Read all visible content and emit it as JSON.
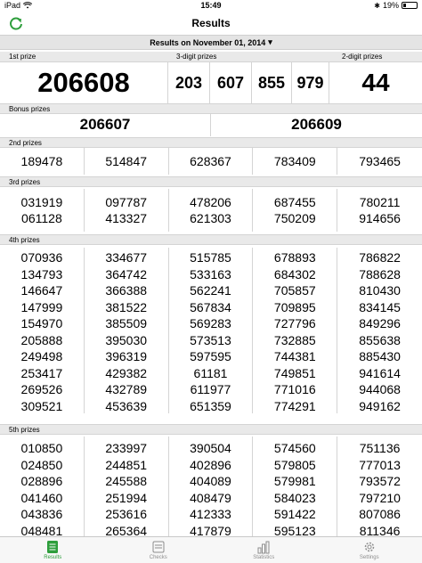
{
  "status": {
    "device": "iPad",
    "time": "15:49",
    "battery": "19%",
    "battery_level": 0.19
  },
  "nav": {
    "title": "Results"
  },
  "date_selector": {
    "label": "Results on November 01, 2014",
    "arrow": "▾"
  },
  "headers": {
    "first": "1st prize",
    "three_digit": "3-digit prizes",
    "two_digit": "2-digit prizes",
    "bonus": "Bonus prizes",
    "second": "2nd prizes",
    "third": "3rd prizes",
    "fourth": "4th prizes",
    "fifth": "5th prizes"
  },
  "first_prize": "206608",
  "three_digit": [
    "203",
    "607",
    "855",
    "979"
  ],
  "two_digit": "44",
  "bonus": [
    "206607",
    "206609"
  ],
  "second": [
    [
      "189478"
    ],
    [
      "514847"
    ],
    [
      "628367"
    ],
    [
      "783409"
    ],
    [
      "793465"
    ]
  ],
  "third": [
    [
      "031919",
      "061128"
    ],
    [
      "097787",
      "413327"
    ],
    [
      "478206",
      "621303"
    ],
    [
      "687455",
      "750209"
    ],
    [
      "780211",
      "914656"
    ]
  ],
  "fourth": [
    [
      "070936",
      "134793",
      "146647",
      "147999",
      "154970",
      "205888",
      "249498",
      "253417",
      "269526",
      "309521"
    ],
    [
      "334677",
      "364742",
      "366388",
      "381522",
      "385509",
      "395030",
      "396319",
      "429382",
      "432789",
      "453639"
    ],
    [
      "515785",
      "533163",
      "562241",
      "567834",
      "569283",
      "573513",
      "597595",
      "61181",
      "611977",
      "651359"
    ],
    [
      "678893",
      "684302",
      "705857",
      "709895",
      "727796",
      "732885",
      "744381",
      "749851",
      "771016",
      "774291"
    ],
    [
      "786822",
      "788628",
      "810430",
      "834145",
      "849296",
      "855638",
      "885430",
      "941614",
      "944068",
      "949162"
    ]
  ],
  "fifth": [
    [
      "010850",
      "024850",
      "028896",
      "041460",
      "043836",
      "048481"
    ],
    [
      "233997",
      "244851",
      "245588",
      "251994",
      "253616",
      "265364"
    ],
    [
      "390504",
      "402896",
      "404089",
      "408479",
      "412333",
      "417879"
    ],
    [
      "574560",
      "579805",
      "579981",
      "584023",
      "591422",
      "595123"
    ],
    [
      "751136",
      "777013",
      "793572",
      "797210",
      "807086",
      "811346"
    ]
  ],
  "tabs": [
    {
      "label": "Results",
      "icon": "results-list-icon",
      "active": true
    },
    {
      "label": "Checks",
      "icon": "ticket-icon",
      "active": false
    },
    {
      "label": "Statistics",
      "icon": "bar-chart-icon",
      "active": false
    },
    {
      "label": "Settings",
      "icon": "gear-icon",
      "active": false
    }
  ],
  "colors": {
    "accent": "#2e9e3c",
    "header_bg": "#e9e9e9",
    "inactive_tab": "#8e8e8e"
  }
}
